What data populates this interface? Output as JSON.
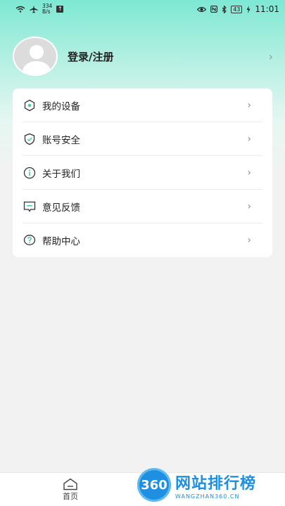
{
  "status_bar": {
    "speed_value": "334",
    "speed_unit": "B/s",
    "battery": "43",
    "time": "11:01"
  },
  "profile": {
    "login_label": "登录/注册"
  },
  "menu": {
    "items": [
      {
        "label": "我的设备",
        "icon": "device-icon"
      },
      {
        "label": "账号安全",
        "icon": "shield-icon"
      },
      {
        "label": "关于我们",
        "icon": "info-icon"
      },
      {
        "label": "意见反馈",
        "icon": "feedback-icon"
      },
      {
        "label": "帮助中心",
        "icon": "help-icon"
      }
    ]
  },
  "bottom_nav": {
    "home_label": "首页"
  },
  "watermark": {
    "logo": "360",
    "title": "网站排行榜",
    "subtitle": "WANGZHAN360.CN"
  },
  "colors": {
    "accent": "#4ac9ad",
    "header_top": "#7de8d3"
  }
}
